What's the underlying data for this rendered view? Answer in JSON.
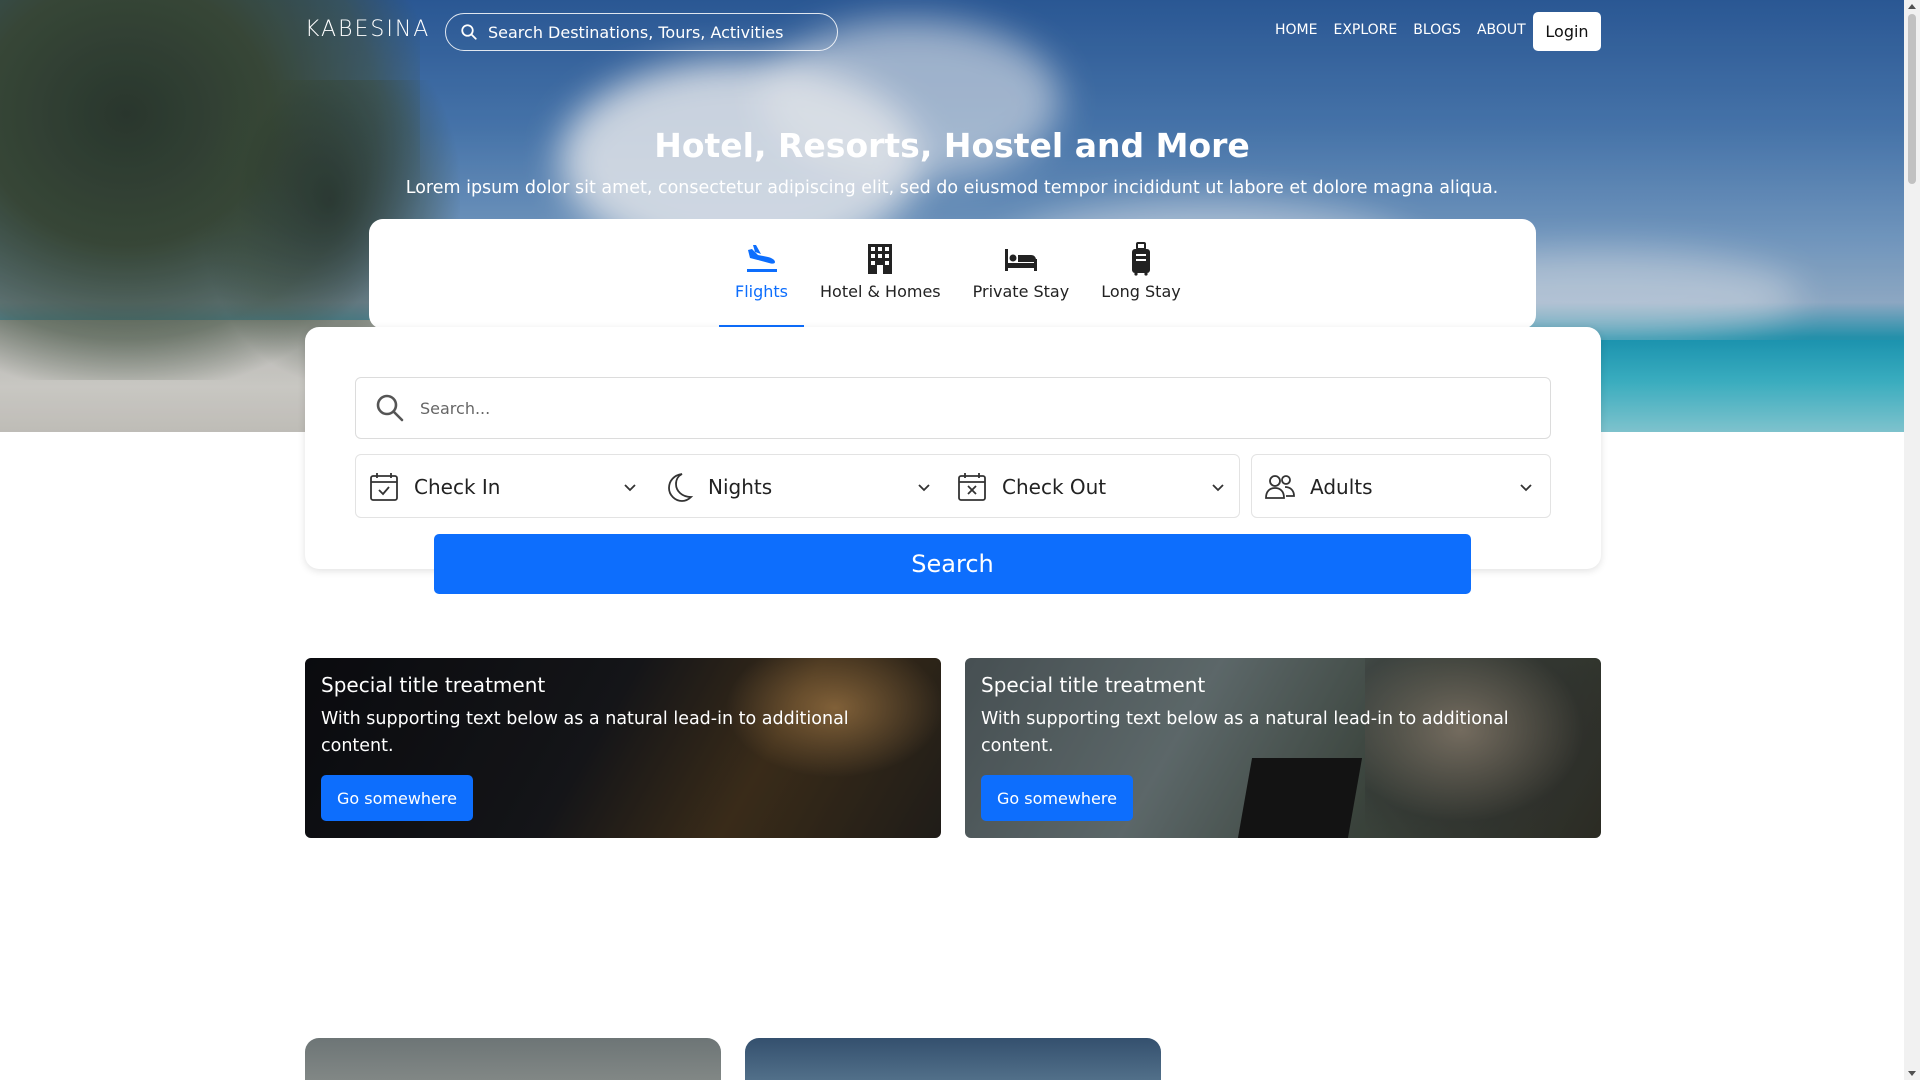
{
  "brand": "KABESINA",
  "nav": {
    "search_placeholder": "Search Destinations, Tours, Activities",
    "links": [
      "HOME",
      "EXPLORE",
      "BLOGS",
      "ABOUT"
    ],
    "login_label": "Login"
  },
  "hero": {
    "title": "Hotel, Resorts, Hostel and More",
    "subtitle": "Lorem ipsum dolor sit amet, consectetur adipiscing elit, sed do eiusmod tempor incididunt ut labore et dolore magna aliqua."
  },
  "tabs": [
    {
      "label": "Flights",
      "icon": "plane-landing-icon",
      "active": true
    },
    {
      "label": "Hotel & Homes",
      "icon": "building-icon",
      "active": false
    },
    {
      "label": "Private Stay",
      "icon": "bed-icon",
      "active": false
    },
    {
      "label": "Long Stay",
      "icon": "suitcase-icon",
      "active": false
    }
  ],
  "search": {
    "placeholder": "Search...",
    "filters": [
      {
        "label": "Check In",
        "icon": "calendar-check-icon"
      },
      {
        "label": "Nights",
        "icon": "moon-icon"
      },
      {
        "label": "Check Out",
        "icon": "calendar-x-icon"
      },
      {
        "label": "Adults",
        "icon": "people-icon"
      }
    ],
    "button_label": "Search"
  },
  "promos": [
    {
      "title": "Special title treatment",
      "text": "With supporting text below as a natural lead-in to additional content.",
      "button_label": "Go somewhere"
    },
    {
      "title": "Special title treatment",
      "text": "With supporting text below as a natural lead-in to additional content.",
      "button_label": "Go somewhere"
    }
  ],
  "colors": {
    "accent": "#0d6efd",
    "white": "#ffffff"
  }
}
